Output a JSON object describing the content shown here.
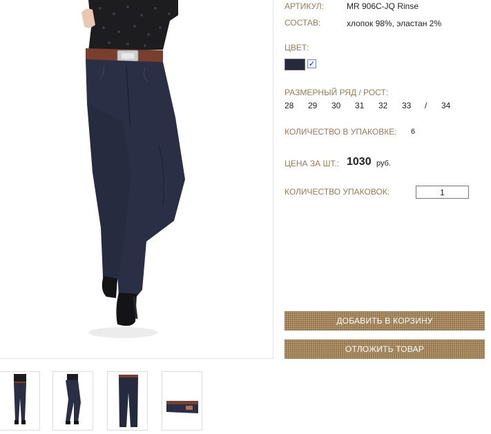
{
  "product": {
    "article_label": "АРТИКУЛ:",
    "article_value": "MR 906C-JQ Rinse",
    "composition_label": "СОСТАВ:",
    "composition_value": "хлопок 98%, эластан 2%",
    "color_label": "ЦВЕТ:",
    "color_swatch": "#262a3c",
    "color_selected": "✓",
    "size_label": "РАЗМЕРНЫЙ РЯД / РОСТ:",
    "sizes": [
      "28",
      "29",
      "30",
      "31",
      "32",
      "33",
      "/",
      "34"
    ],
    "pack_qty_label": "КОЛИЧЕСТВО В УПАКОВКЕ:",
    "pack_qty_value": "6",
    "price_label": "ЦЕНА ЗА ШТ.:",
    "price_value": "1030",
    "price_currency": "руб.",
    "order_qty_label": "КОЛИЧЕСТВО УПАКОВОК:",
    "order_qty_value": "1"
  },
  "buttons": {
    "add_to_cart": "ДОБАВИТЬ В КОРЗИНУ",
    "postpone": "ОТЛОЖИТЬ ТОВАР"
  },
  "colors": {
    "label_brown": "#9a7a52",
    "button_brown": "#a07d50",
    "denim": "#262a3c"
  },
  "thumbnails": [
    "front-view",
    "side-view",
    "flat-view",
    "waistband-detail"
  ]
}
